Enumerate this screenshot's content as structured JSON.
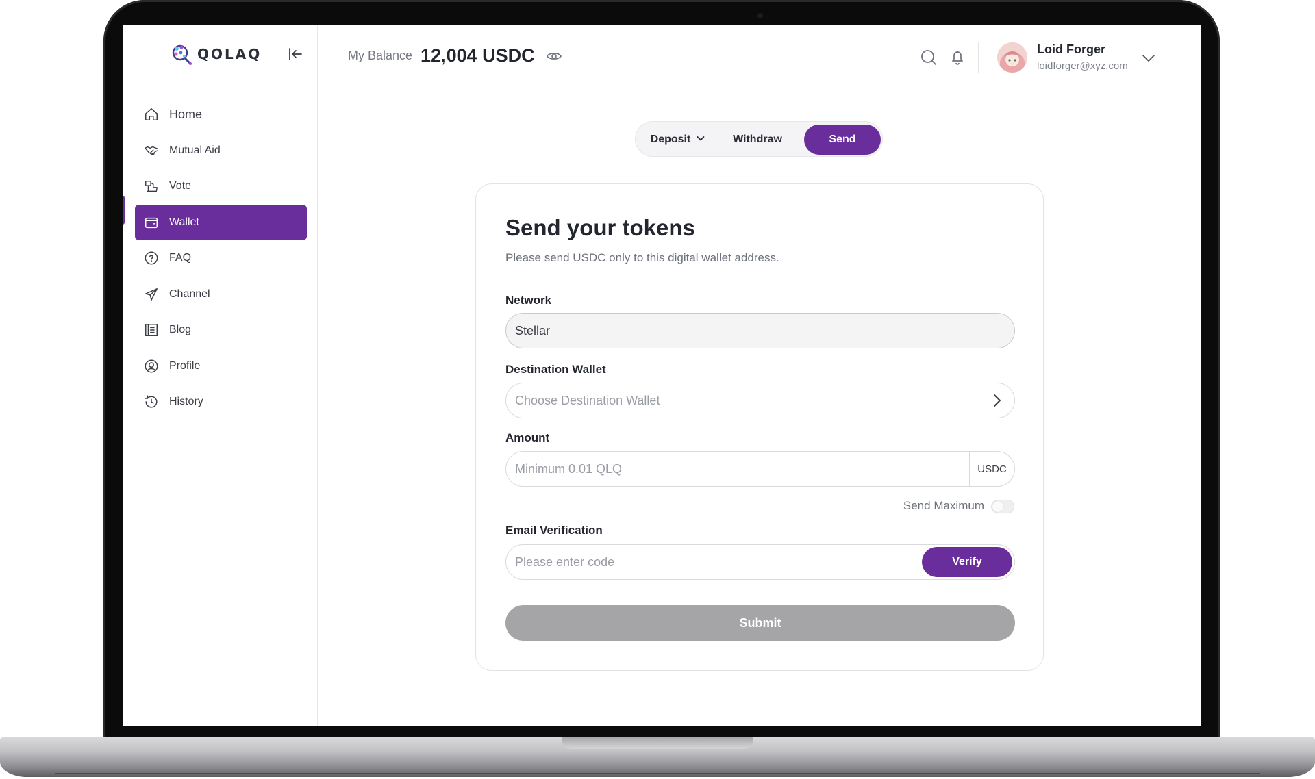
{
  "app": {
    "logo_text": "QOLAQ"
  },
  "sidebar": {
    "items": [
      {
        "label": "Home",
        "icon": "home-icon"
      },
      {
        "label": "Mutual Aid",
        "icon": "handshake-icon"
      },
      {
        "label": "Vote",
        "icon": "vote-icon"
      },
      {
        "label": "Wallet",
        "icon": "wallet-icon",
        "active": true
      },
      {
        "label": "FAQ",
        "icon": "question-icon"
      },
      {
        "label": "Channel",
        "icon": "send-plane-icon"
      },
      {
        "label": "Blog",
        "icon": "blog-icon"
      },
      {
        "label": "Profile",
        "icon": "profile-icon"
      },
      {
        "label": "History",
        "icon": "history-icon"
      }
    ]
  },
  "header": {
    "balance_label": "My Balance",
    "balance_value": "12,004 USDC",
    "user": {
      "name": "Loid Forger",
      "email": "loidforger@xyz.com"
    }
  },
  "tabs": {
    "deposit": "Deposit",
    "withdraw": "Withdraw",
    "send": "Send",
    "active": "Send"
  },
  "form": {
    "title": "Send your tokens",
    "subtitle": "Please send USDC only to this digital wallet address.",
    "network_label": "Network",
    "network_value": "Stellar",
    "destination_label": "Destination Wallet",
    "destination_placeholder": "Choose Destination Wallet",
    "amount_label": "Amount",
    "amount_placeholder": "Minimum 0.01 QLQ",
    "amount_unit": "USDC",
    "send_max_label": "Send Maximum",
    "send_max_enabled": false,
    "email_label": "Email Verification",
    "email_placeholder": "Please enter code",
    "verify_label": "Verify",
    "submit_label": "Submit"
  },
  "colors": {
    "accent": "#6a2e9c",
    "submit_disabled": "#a5a5a8"
  }
}
